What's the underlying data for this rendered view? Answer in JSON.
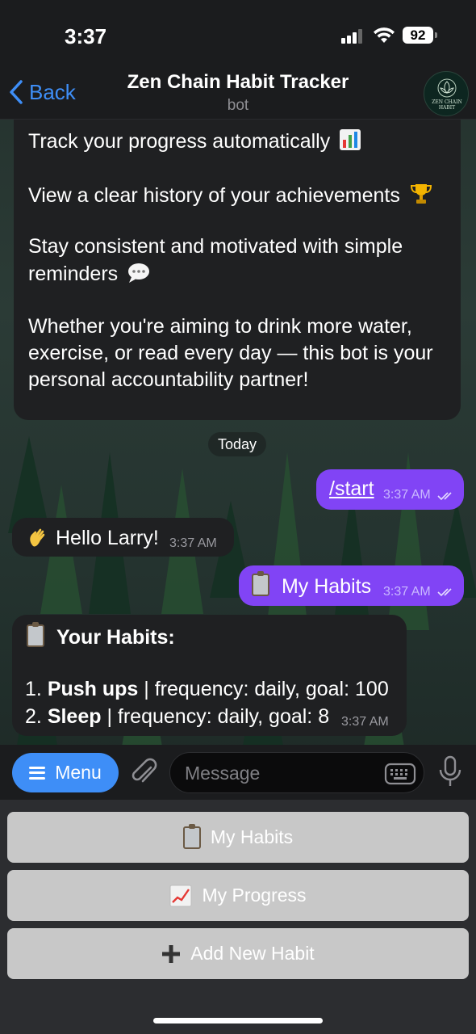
{
  "status_bar": {
    "time": "3:37",
    "battery": "92"
  },
  "nav": {
    "back_label": "Back",
    "title": "Zen Chain Habit Tracker",
    "subtitle": "bot",
    "avatar_text": "ZEN CHAIN HABIT"
  },
  "chat": {
    "intro_lines": [
      "Track your progress automatically",
      "View a clear history of your achievements",
      "Stay consistent and motivated with simple",
      "reminders",
      "Whether you're aiming to drink more water,",
      "exercise, or read every day — this bot is your",
      "personal accountability partner!"
    ],
    "date_separator": "Today",
    "messages": [
      {
        "direction": "out",
        "text": "/start",
        "time": "3:37 AM"
      },
      {
        "direction": "in",
        "text": "Hello Larry!",
        "time": "3:37 AM"
      },
      {
        "direction": "out",
        "text": "My Habits",
        "time": "3:37 AM"
      }
    ],
    "habits_message": {
      "heading": "Your Habits:",
      "items": [
        {
          "num": "1.",
          "name": "Push ups",
          "detail": " | frequency: daily, goal: 100"
        },
        {
          "num": "2.",
          "name": "Sleep",
          "detail": " | frequency: daily, goal: 8"
        }
      ],
      "time": "3:37 AM"
    }
  },
  "input": {
    "menu_label": "Menu",
    "placeholder": "Message"
  },
  "keyboard_buttons": [
    {
      "label": "My Habits",
      "icon": "clipboard-icon"
    },
    {
      "label": "My Progress",
      "icon": "chart-increasing-icon"
    },
    {
      "label": "Add New Habit",
      "icon": "plus-icon"
    }
  ],
  "colors": {
    "accent": "#3e8ef7",
    "outgoing_bubble": "#8144f5",
    "incoming_bubble": "#1f2022",
    "keyboard_button": "#c8c8c8"
  }
}
